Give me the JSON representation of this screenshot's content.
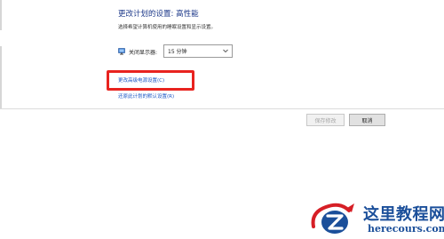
{
  "plan": {
    "title": "更改计划的设置: 高性能",
    "subtitle": "选择希望计算机使用的睡眠设置和显示设置。",
    "display_label": "关闭显示器:",
    "display_value": "15 分钟",
    "advanced_link": "更改高级电源设置(C)",
    "restore_link": "还原此计划的默认设置(R)"
  },
  "buttons": {
    "save": "保存修改",
    "cancel": "取消"
  },
  "watermark": {
    "name": "这里教程网",
    "url": "herecours.com"
  },
  "colors": {
    "title": "#1e3a8a",
    "link": "#1a56c5",
    "highlight": "#e8231f",
    "watermark_blue": "#1b4f9a",
    "watermark_red": "#d61f26"
  },
  "icons": {
    "monitor": "monitor-icon",
    "dropdown": "chevron-down-icon"
  }
}
